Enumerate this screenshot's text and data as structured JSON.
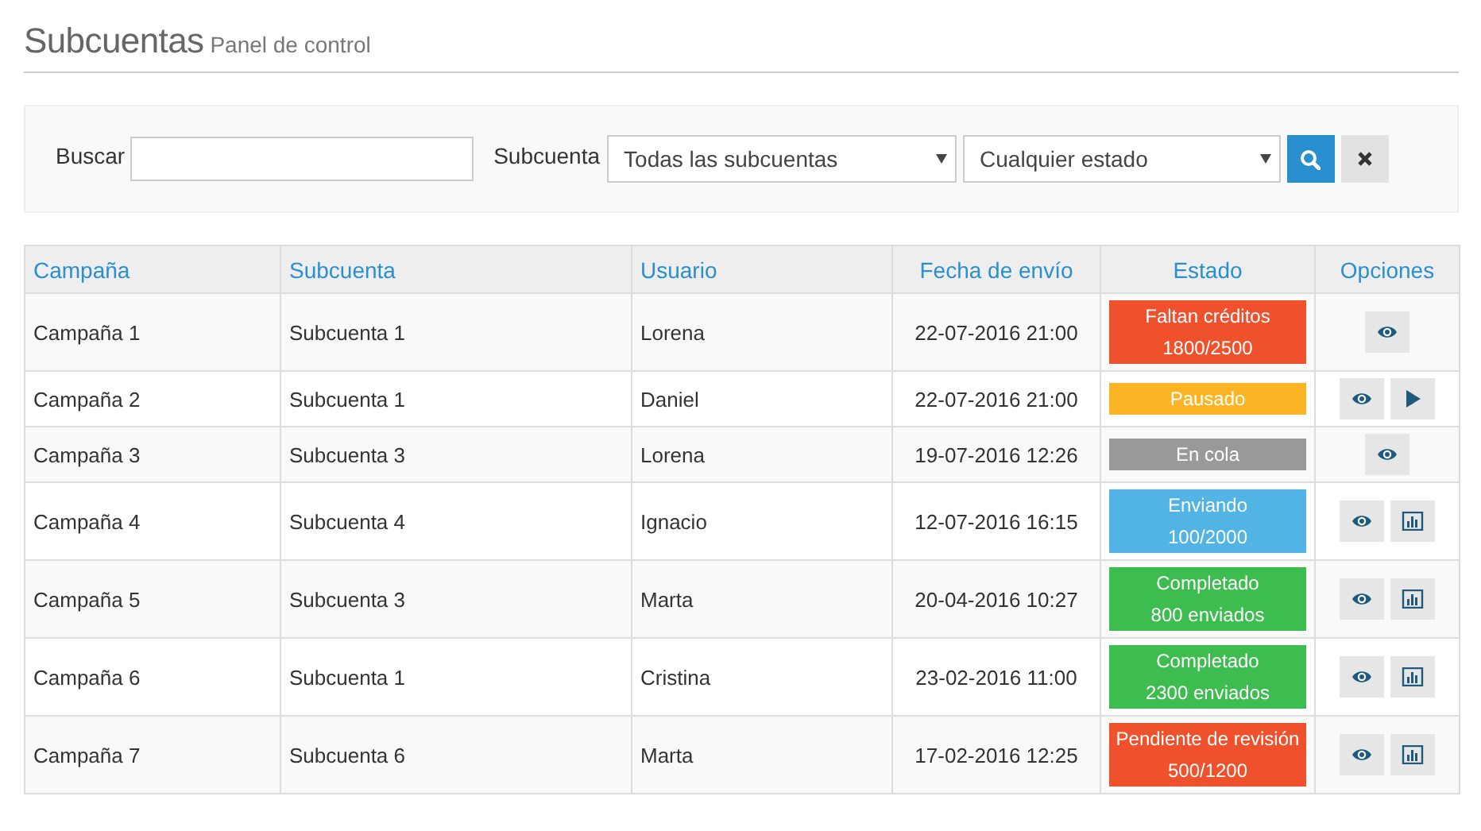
{
  "header": {
    "title": "Subcuentas",
    "subtitle": "Panel de control"
  },
  "filters": {
    "search_label": "Buscar",
    "subaccount_label": "Subcuenta",
    "subaccount_select": "Todas las subcuentas",
    "status_select": "Cualquier estado"
  },
  "table": {
    "columns": [
      "Campaña",
      "Subcuenta",
      "Usuario",
      "Fecha de envío",
      "Estado",
      "Opciones"
    ],
    "rows": [
      {
        "cells": [
          "Campaña 1",
          "Subcuenta 1",
          "Lorena",
          "22-07-2016 21:00"
        ],
        "status": {
          "lines": [
            "Faltan créditos",
            "1800/2500"
          ],
          "color": "#ef512c"
        },
        "actions": [
          {
            "kind": "view"
          }
        ]
      },
      {
        "cells": [
          "Campaña 2",
          "Subcuenta 1",
          "Daniel",
          "22-07-2016 21:00"
        ],
        "status": {
          "lines": [
            "Pausado"
          ],
          "color": "#fbb424"
        },
        "actions": [
          {
            "kind": "view"
          },
          {
            "kind": "play"
          }
        ]
      },
      {
        "cells": [
          "Campaña 3",
          "Subcuenta 3",
          "Lorena",
          "19-07-2016 12:26"
        ],
        "status": {
          "lines": [
            "En cola"
          ],
          "color": "#999999"
        },
        "actions": [
          {
            "kind": "view"
          }
        ]
      },
      {
        "cells": [
          "Campaña 4",
          "Subcuenta 4",
          "Ignacio",
          "12-07-2016 16:15"
        ],
        "status": {
          "lines": [
            "Enviando",
            "100/2000"
          ],
          "color": "#52b3e5"
        },
        "actions": [
          {
            "kind": "view"
          },
          {
            "kind": "stats"
          }
        ]
      },
      {
        "cells": [
          "Campaña 5",
          "Subcuenta 3",
          "Marta",
          "20-04-2016 10:27"
        ],
        "status": {
          "lines": [
            "Completado",
            "800 enviados"
          ],
          "color": "#3dbd4f"
        },
        "actions": [
          {
            "kind": "view"
          },
          {
            "kind": "stats"
          }
        ]
      },
      {
        "cells": [
          "Campaña 6",
          "Subcuenta 1",
          "Cristina",
          "23-02-2016 11:00"
        ],
        "status": {
          "lines": [
            "Completado",
            "2300 enviados"
          ],
          "color": "#3dbd4f"
        },
        "actions": [
          {
            "kind": "view"
          },
          {
            "kind": "stats"
          }
        ]
      },
      {
        "cells": [
          "Campaña 7",
          "Subcuenta 6",
          "Marta",
          "17-02-2016 12:25"
        ],
        "status": {
          "lines": [
            "Pendiente de revisión",
            "500/1200"
          ],
          "color": "#ef512c"
        },
        "actions": [
          {
            "kind": "view"
          },
          {
            "kind": "stats"
          }
        ]
      }
    ]
  }
}
